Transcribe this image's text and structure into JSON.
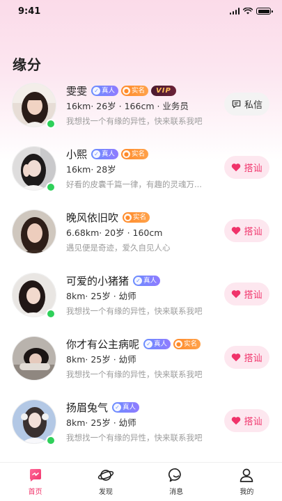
{
  "status": {
    "time": "9:41"
  },
  "page": {
    "title": "缘分"
  },
  "colors": {
    "accent": "#f0336a",
    "online": "#2fd05a",
    "real_badge": "#6a8dff",
    "verified_badge": "#ff8a2a"
  },
  "users": [
    {
      "name": "雯雯",
      "badges": {
        "real": "真人",
        "verified": "实名",
        "vip": "VIP"
      },
      "meta": "16km· 26岁 · 166cm · 业务员",
      "bio": "我想找一个有缘的异性，快来联系我吧",
      "online": true,
      "action": {
        "label": "私信",
        "type": "message",
        "icon": "chat-icon"
      }
    },
    {
      "name": "小熙",
      "badges": {
        "real": "真人",
        "verified": "实名"
      },
      "meta": "16km· 28岁",
      "bio": "好看的皮囊千篇一律，有趣的灵魂万...",
      "online": true,
      "action": {
        "label": "搭讪",
        "type": "flirt",
        "icon": "heart-icon"
      }
    },
    {
      "name": "晚风依旧吹",
      "badges": {
        "verified": "实名"
      },
      "meta": "6.68km· 20岁 · 160cm",
      "bio": "遇见便是奇迹，爱久自见人心",
      "online": false,
      "action": {
        "label": "搭讪",
        "type": "flirt",
        "icon": "heart-icon"
      }
    },
    {
      "name": "可爱的小猪猪",
      "badges": {
        "real": "真人"
      },
      "meta": "8km· 25岁 · 幼师",
      "bio": "我想找一个有缘的异性，快来联系我吧",
      "online": true,
      "action": {
        "label": "搭讪",
        "type": "flirt",
        "icon": "heart-icon"
      }
    },
    {
      "name": "你才有公主病呢",
      "badges": {
        "real": "真人",
        "verified": "实名"
      },
      "meta": "8km· 25岁 · 幼师",
      "bio": "我想找一个有缘的异性，快来联系我吧",
      "online": false,
      "action": {
        "label": "搭讪",
        "type": "flirt",
        "icon": "heart-icon"
      }
    },
    {
      "name": "扬眉兔气",
      "badges": {
        "real": "真人"
      },
      "meta": "8km· 25岁 · 幼师",
      "bio": "我想找一个有缘的异性，快来联系我吧",
      "online": true,
      "action": {
        "label": "搭讪",
        "type": "flirt",
        "icon": "heart-icon"
      }
    }
  ],
  "tabbar": [
    {
      "label": "首页",
      "icon": "home-heart-icon",
      "active": true
    },
    {
      "label": "发现",
      "icon": "planet-icon",
      "active": false
    },
    {
      "label": "消息",
      "icon": "chat-bubble-icon",
      "active": false
    },
    {
      "label": "我的",
      "icon": "profile-icon",
      "active": false
    }
  ]
}
